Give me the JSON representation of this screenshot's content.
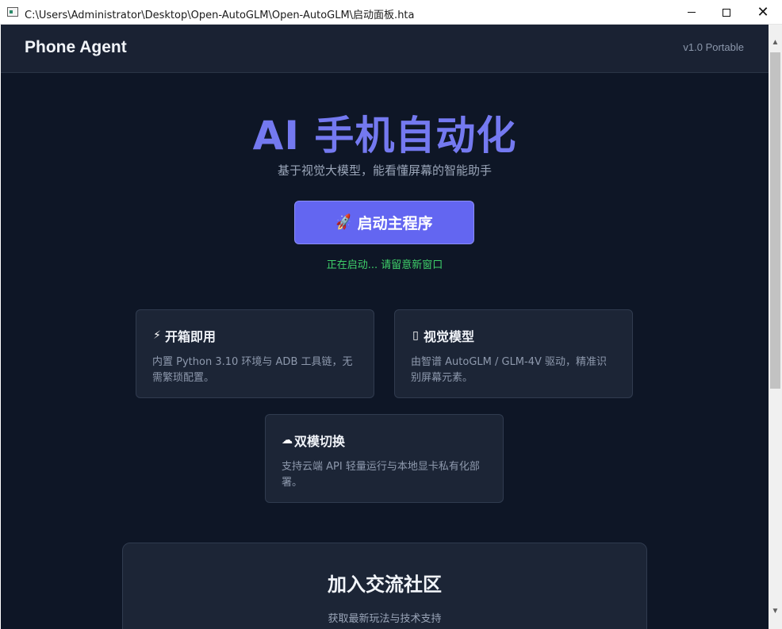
{
  "window": {
    "title": "C:\\Users\\Administrator\\Desktop\\Open-AutoGLM\\Open-AutoGLM\\启动面板.hta",
    "minimize_glyph": "",
    "close_glyph": "✕"
  },
  "header": {
    "brand": "Phone Agent",
    "version": "v1.0 Portable"
  },
  "hero": {
    "title": "AI 手机自动化",
    "subtitle": "基于视觉大模型，能看懂屏幕的智能助手"
  },
  "launch": {
    "icon": "🚀",
    "label": "启动主程序",
    "status": "正在启动... 请留意新窗口"
  },
  "features": [
    {
      "icon": "⚡",
      "icon_name": "lightning-icon",
      "title": "开箱即用",
      "desc": "内置 Python 3.10 环境与 ADB 工具链，无需繁琐配置。"
    },
    {
      "icon": "▯",
      "icon_name": "eye-icon",
      "title": "视觉模型",
      "desc": "由智谱 AutoGLM / GLM-4V 驱动，精准识别屏幕元素。"
    },
    {
      "icon": "☁",
      "icon_name": "cloud-icon",
      "title": "双模切换",
      "desc": "支持云端 API 轻量运行与本地显卡私有化部署。"
    }
  ],
  "community": {
    "title": "加入交流社区",
    "subtitle": "获取最新玩法与技术支持"
  },
  "scrollbar": {
    "up_glyph": "▲",
    "down_glyph": "▼"
  },
  "colors": {
    "accent": "#6366f1",
    "background": "#0e1626",
    "card": "#1c2536",
    "status": "#3fd06a"
  }
}
